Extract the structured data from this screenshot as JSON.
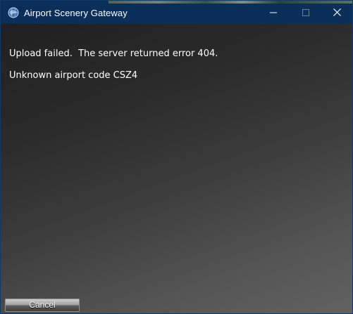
{
  "window": {
    "title": "Airport Scenery Gateway",
    "app_icon": "globe-icon",
    "controls": {
      "minimize_icon": "minimize-icon",
      "maximize_icon": "maximize-icon",
      "close_icon": "close-icon"
    }
  },
  "dialog": {
    "error_message": "Upload failed.  The server returned error 404.",
    "detail_message": "Unknown airport code CSZ4",
    "cancel_label": "Cancel"
  },
  "colors": {
    "titlebar": "#0b2e5a",
    "text": "#ffffff"
  }
}
